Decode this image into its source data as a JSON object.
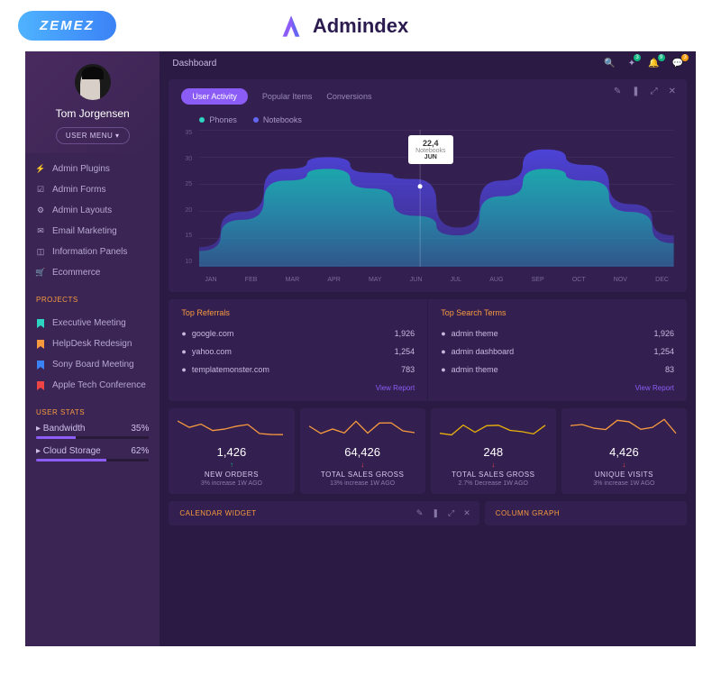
{
  "brand": {
    "badge": "ZEMEZ",
    "name": "Admindex"
  },
  "sidebar": {
    "username": "Tom Jorgensen",
    "user_menu": "USER MENU ▾",
    "nav": [
      {
        "icon": "bolt",
        "label": "Admin Plugins"
      },
      {
        "icon": "check",
        "label": "Admin Forms"
      },
      {
        "icon": "gear",
        "label": "Admin Layouts"
      },
      {
        "icon": "mail",
        "label": "Email Marketing"
      },
      {
        "icon": "bars",
        "label": "Information Panels"
      },
      {
        "icon": "cart",
        "label": "Ecommerce"
      }
    ],
    "projects_head": "PROJECTS",
    "projects": [
      {
        "color": "#2dd4bf",
        "label": "Executive Meeting"
      },
      {
        "color": "#f79a3e",
        "label": "HelpDesk Redesign"
      },
      {
        "color": "#3b82f6",
        "label": "Sony Board Meeting"
      },
      {
        "color": "#ef4444",
        "label": "Apple Tech Conference"
      }
    ],
    "stats_head": "USER STATS",
    "stats": [
      {
        "icon": "band",
        "label": "Bandwidth",
        "pct": "35%",
        "val": 35
      },
      {
        "icon": "cloud",
        "label": "Cloud Storage",
        "pct": "62%",
        "val": 62
      }
    ]
  },
  "topbar": {
    "title": "Dashboard",
    "icons": [
      {
        "name": "search",
        "badge": null,
        "color": null
      },
      {
        "name": "wand",
        "badge": "3",
        "color": "#10b981"
      },
      {
        "name": "bell",
        "badge": "9",
        "color": "#10b981"
      },
      {
        "name": "chat",
        "badge": "3",
        "color": "#f59e0b"
      }
    ]
  },
  "chart": {
    "tabs": [
      "User Activity",
      "Popular Items",
      "Conversions"
    ],
    "legend": [
      {
        "label": "Phones",
        "color": "#2dd4bf"
      },
      {
        "label": "Notebooks",
        "color": "#6366f1"
      }
    ],
    "tooltip": {
      "value": "22,4",
      "label": "Notebooks",
      "month": "JUN"
    },
    "months": [
      "JAN",
      "FEB",
      "MAR",
      "APR",
      "MAY",
      "JUN",
      "JUL",
      "AUG",
      "SEP",
      "OCT",
      "NOV",
      "DEC"
    ],
    "y_ticks": [
      "35",
      "30",
      "25",
      "20",
      "15",
      "10"
    ]
  },
  "chart_data": {
    "type": "area",
    "title": "User Activity",
    "xlabel": "",
    "ylabel": "",
    "ylim": [
      0,
      35
    ],
    "categories": [
      "JAN",
      "FEB",
      "MAR",
      "APR",
      "MAY",
      "JUN",
      "JUL",
      "AUG",
      "SEP",
      "OCT",
      "NOV",
      "DEC"
    ],
    "series": [
      {
        "name": "Phones",
        "color": "#2dd4bf",
        "values": [
          4,
          12,
          22,
          25,
          20,
          13,
          8,
          18,
          25,
          22,
          14,
          6
        ]
      },
      {
        "name": "Notebooks",
        "color": "#6366f1",
        "values": [
          5,
          14,
          25,
          28,
          24,
          22.4,
          10,
          22,
          30,
          26,
          16,
          8
        ]
      }
    ]
  },
  "referrals": {
    "title": "Top Referrals",
    "rows": [
      {
        "label": "google.com",
        "value": "1,926"
      },
      {
        "label": "yahoo.com",
        "value": "1,254"
      },
      {
        "label": "templatemonster.com",
        "value": "783"
      }
    ],
    "link": "View Report"
  },
  "searchterms": {
    "title": "Top Search Terms",
    "rows": [
      {
        "label": "admin theme",
        "value": "1,926"
      },
      {
        "label": "admin dashboard",
        "value": "1,254"
      },
      {
        "label": "admin theme",
        "value": "83"
      }
    ],
    "link": "View Report"
  },
  "stats_cards": [
    {
      "value": "1,426",
      "arrow": "↑",
      "arrow_color": "#10b981",
      "label": "NEW ORDERS",
      "sub": "3% increase 1W AGO",
      "color": "#f79a3e"
    },
    {
      "value": "64,426",
      "arrow": "↓",
      "arrow_color": "#ef4444",
      "label": "TOTAL SALES GROSS",
      "sub": "13% increase 1W AGO",
      "color": "#f79a3e"
    },
    {
      "value": "248",
      "arrow": "↓",
      "arrow_color": "#ef4444",
      "label": "TOTAL SALES GROSS",
      "sub": "2.7% Decrease 1W AGO",
      "color": "#eab308"
    },
    {
      "value": "4,426",
      "arrow": "↓",
      "arrow_color": "#ef4444",
      "label": "UNIQUE VISITS",
      "sub": "3% increase 1W AGO",
      "color": "#f79a3e"
    }
  ],
  "bottom": {
    "calendar": "CALENDAR WIDGET",
    "column": "COLUMN GRAPH"
  }
}
